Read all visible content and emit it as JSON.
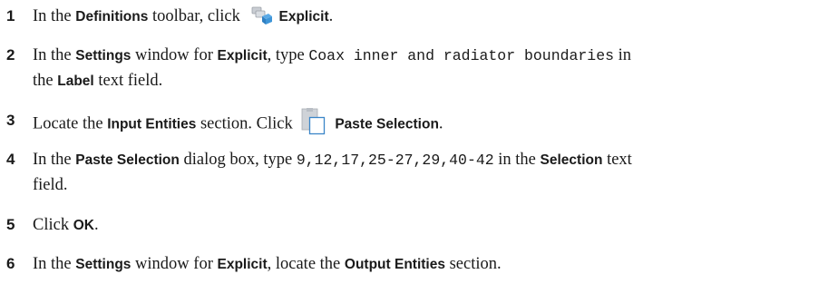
{
  "steps": [
    {
      "number": "1",
      "parts": {
        "t1": "In the ",
        "b1": "Definitions",
        "t2": " toolbar, click ",
        "icon": "explicit-selection-icon",
        "b2": "Explicit",
        "t3": "."
      }
    },
    {
      "number": "2",
      "parts": {
        "t1": "In the ",
        "b1": "Settings",
        "t2": " window for ",
        "b2": "Explicit",
        "t3": ", type ",
        "m1": "Coax inner and radiator boundaries",
        "t4": " in",
        "t5": "the ",
        "b3": "Label",
        "t6": " text field."
      }
    },
    {
      "number": "3",
      "parts": {
        "t1": "Locate the ",
        "b1": "Input Entities",
        "t2": " section. Click ",
        "icon": "paste-selection-icon",
        "b2": "Paste Selection",
        "t3": "."
      }
    },
    {
      "number": "4",
      "parts": {
        "t1": "In the ",
        "b1": "Paste Selection",
        "t2": " dialog box, type ",
        "m1": "9,12,17,25-27,29,40-42",
        "t3": " in the ",
        "b2": "Selection",
        "t4": " text",
        "t5": "field."
      }
    },
    {
      "number": "5",
      "parts": {
        "t1": "Click ",
        "b1": "OK",
        "t2": "."
      }
    },
    {
      "number": "6",
      "parts": {
        "t1": "In the ",
        "b1": "Settings",
        "t2": " window for ",
        "b2": "Explicit",
        "t3": ", locate the ",
        "b3": "Output Entities",
        "t4": " section."
      }
    }
  ]
}
